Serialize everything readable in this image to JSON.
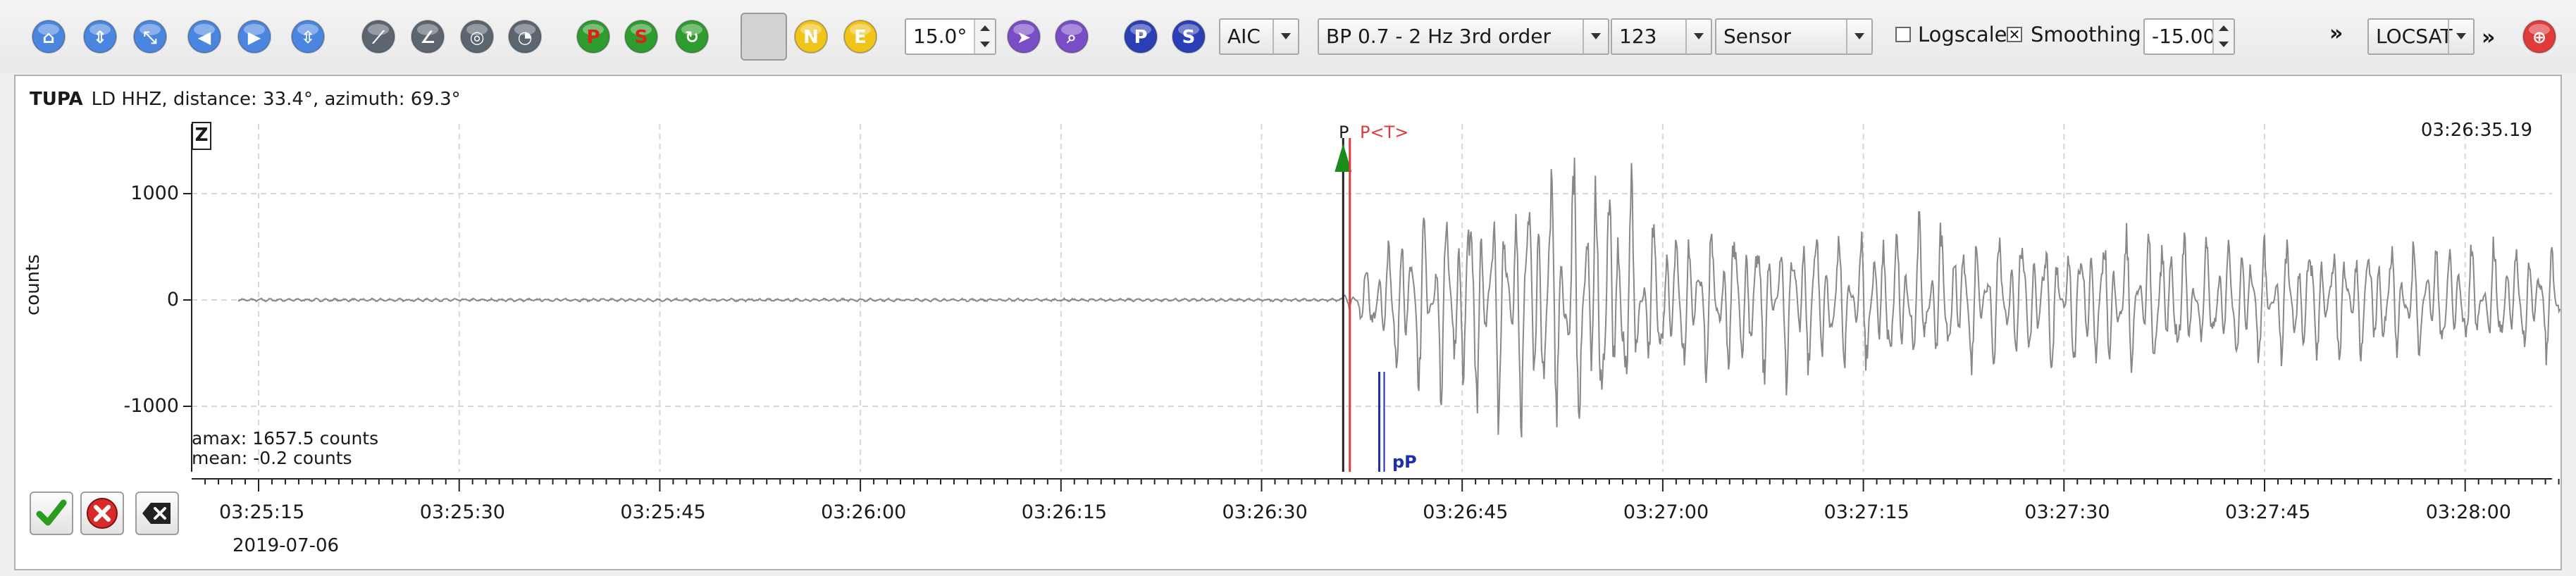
{
  "toolbar": {
    "filter_window": "15.0°",
    "picker": "AIC",
    "filter": "BP 0.7 - 2 Hz  3rd order",
    "filter_id": "123",
    "unit": "Sensor",
    "logscale_label": "Logscale",
    "smoothing_label": "Smoothing",
    "amplitude_value": "-15.00",
    "locator": "LOCSAT",
    "more": "»",
    "more2": "»",
    "comp_z": "Z",
    "comp_n": "N",
    "comp_e": "E",
    "btn_p": "P",
    "btn_s": "S",
    "icons": [
      "home-icon",
      "scroll-up-icon",
      "shrink-icon",
      "step-back-icon",
      "step-forward-icon",
      "expand-icon",
      "pick-tool-icon",
      "angle-tool-icon",
      "magnify-icon",
      "gauge-icon",
      "p-red-icon",
      "s-red-icon",
      "reset-icon",
      "z-icon",
      "n-icon",
      "e-icon",
      "purple-arrow-icon",
      "purple-zoom-icon",
      "p-blue-icon",
      "s-blue-icon",
      "target-icon"
    ]
  },
  "trace": {
    "station": "TUPA",
    "channel_info": "LD  HHZ, distance: 33.4°, azimuth: 69.3°",
    "component": "Z",
    "end_time": "03:26:35.19",
    "y_title": "counts",
    "amax": "amax: 1657.5 counts",
    "mean": "mean: -0.2 counts",
    "date": "2019-07-06",
    "phases": {
      "p": "P",
      "p_theory": "P<T>",
      "pp": "pP"
    }
  },
  "colors": {
    "accent": "#2a6ad6",
    "pick_red": "#e03a3a",
    "theory_blue": "#1c2fb3",
    "arrow_green": "#1a8c1a",
    "trace": "#888888"
  },
  "chart_data": {
    "type": "line",
    "xlabel": "",
    "ylabel": "counts",
    "ylim": [
      -1600,
      1660
    ],
    "y_ticks": [
      1000,
      0,
      -1000
    ],
    "y_tick_labels": [
      "1000",
      "0",
      "-1000"
    ],
    "x_ticks": [
      "03:25:15",
      "03:25:30",
      "03:25:45",
      "03:26:00",
      "03:26:15",
      "03:26:30",
      "03:26:45",
      "03:27:00",
      "03:27:15",
      "03:27:30",
      "03:27:45",
      "03:28:00"
    ],
    "xlim_seconds": [
      -1.5,
      178
    ],
    "phases": [
      {
        "name": "P",
        "time": "03:26:36.1"
      },
      {
        "name": "P<T>",
        "time": "03:26:36.6"
      },
      {
        "name": "pP",
        "time": "03:26:38.8"
      }
    ],
    "grid": true,
    "envelope": [
      {
        "t": "03:25:15",
        "amp": 15
      },
      {
        "t": "03:26:36",
        "amp": 15
      },
      {
        "t": "03:26:40",
        "amp": 900
      },
      {
        "t": "03:26:49",
        "amp": 1400
      },
      {
        "t": "03:26:55",
        "amp": 1600
      },
      {
        "t": "03:27:00",
        "amp": 900
      },
      {
        "t": "03:27:30",
        "amp": 800
      },
      {
        "t": "03:28:05",
        "amp": 650
      }
    ]
  }
}
